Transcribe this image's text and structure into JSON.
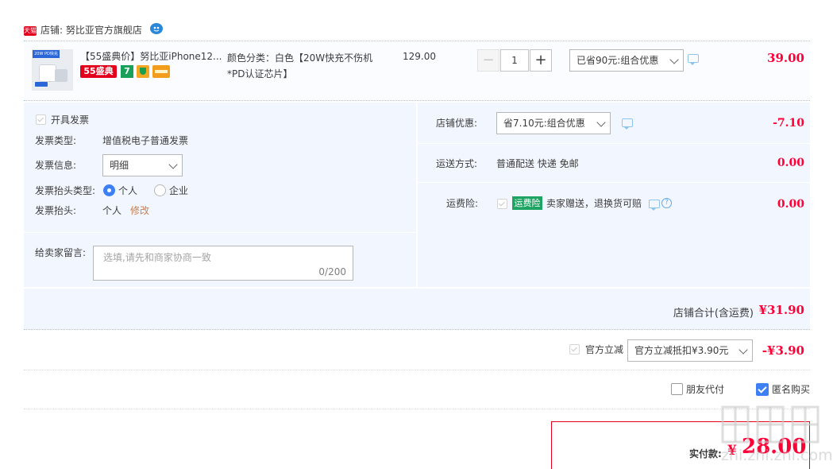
{
  "shop": {
    "badge": "天猫",
    "label": "店铺: 努比亚官方旗舰店"
  },
  "item": {
    "title": "【55盛典价】努比亚iPhone12...",
    "badge_55": "55盛典",
    "badge_7": "7",
    "thumb_tag": "20W PD快充",
    "sku": "颜色分类：白色【20W快充不伤机*PD认证芯片】",
    "unit_price": "129.00",
    "qty_minus": "−",
    "qty_value": "1",
    "qty_plus": "+",
    "promo": "已省90元:组合优惠",
    "subtotal": "39.00"
  },
  "invoice": {
    "open_label": "开具发票",
    "type_label": "发票类型:",
    "type_value": "增值税电子普通发票",
    "info_label": "发票信息:",
    "info_value": "明细",
    "head_type_label": "发票抬头类型:",
    "head_type_personal": "个人",
    "head_type_company": "企业",
    "head_label": "发票抬头:",
    "head_value": "个人",
    "head_edit": "修改"
  },
  "message": {
    "label": "给卖家留言:",
    "placeholder": "选填,请先和商家协商一致",
    "count": "0/200"
  },
  "shop_discount": {
    "label": "店铺优惠:",
    "value": "省7.10元:组合优惠",
    "amount": "-7.10"
  },
  "shipping": {
    "label": "运送方式:",
    "value": "普通配送 快递 免邮",
    "amount": "0.00"
  },
  "insurance": {
    "label": "运费险:",
    "badge": "运费险",
    "text": "卖家赠送，退换货可赔",
    "help": "?",
    "amount": "0.00"
  },
  "shop_total": {
    "label": "店铺合计(含运费)",
    "value": "¥31.90"
  },
  "official": {
    "label": "官方立减",
    "select": "官方立减抵扣¥3.90元",
    "amount": "-¥3.90"
  },
  "options": {
    "friend_pay": "朋友代付",
    "anonymous": "匿名购买"
  },
  "payment": {
    "label": "实付款:",
    "yen": "¥",
    "value": "28.00"
  },
  "watermark": {
    "text": "zhi.zhi.zhi.com"
  },
  "colors": {
    "price_red": "#ff0036",
    "panel_bg": "#f2f7ff",
    "tmall_red": "#e4001c",
    "accent_blue": "#3d7ff4",
    "fee_green": "#1ea462"
  }
}
